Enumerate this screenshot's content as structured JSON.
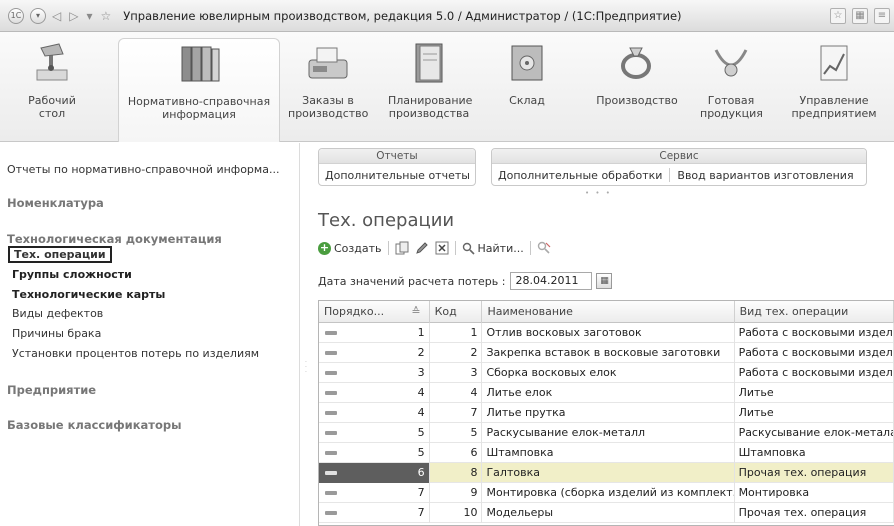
{
  "window": {
    "title": "Управление ювелирным производством, редакция 5.0 / Администратор / (1С:Предприятие)"
  },
  "sections": [
    {
      "label": "Рабочий\nстол",
      "icon": "desk-lamp-icon"
    },
    {
      "label": "Нормативно-справочная\nинформация",
      "icon": "binders-icon",
      "active": true
    },
    {
      "label": "Заказы в\nпроизводство",
      "icon": "fax-icon"
    },
    {
      "label": "Планирование\nпроизводства",
      "icon": "planner-book-icon"
    },
    {
      "label": "Склад",
      "icon": "safe-icon"
    },
    {
      "label": "Производство",
      "icon": "ring-icon"
    },
    {
      "label": "Готовая\nпродукция",
      "icon": "necklace-icon"
    },
    {
      "label": "Управление\nпредприятием",
      "icon": "report-chart-icon"
    }
  ],
  "nav": {
    "top_link": "Отчеты по нормативно-справочной информа...",
    "groups": [
      {
        "title": "Номенклатура",
        "items": []
      },
      {
        "title": "Технологическая документация",
        "items": [
          {
            "label": "Тех. операции",
            "selected": true,
            "bold": true
          },
          {
            "label": "Группы сложности",
            "bold": true
          },
          {
            "label": "Технологические карты",
            "bold": true
          },
          {
            "label": "Виды дефектов"
          },
          {
            "label": "Причины брака"
          },
          {
            "label": "Установки процентов потерь по изделиям"
          }
        ]
      },
      {
        "title": "Предприятие",
        "items": []
      },
      {
        "title": "Базовые классификаторы",
        "items": []
      }
    ]
  },
  "commands": {
    "reports": {
      "header": "Отчеты",
      "items": [
        "Дополнительные отчеты"
      ]
    },
    "service": {
      "header": "Сервис",
      "items": [
        "Дополнительные обработки",
        "Ввод вариантов изготовления"
      ]
    }
  },
  "form": {
    "title": "Тех. операции",
    "toolbar": {
      "create": "Создать",
      "find": "Найти..."
    },
    "date_label": "Дата значений расчета потерь :",
    "date_value": "28.04.2011",
    "columns": [
      "Порядко...",
      "Код",
      "Наименование",
      "Вид тех. операции"
    ],
    "rows": [
      {
        "order": "1",
        "code": "1",
        "name": "Отлив восковых заготовок",
        "type": "Работа с восковыми издел"
      },
      {
        "order": "2",
        "code": "2",
        "name": "Закрепка вставок в восковые заготовки",
        "type": "Работа с восковыми издел"
      },
      {
        "order": "3",
        "code": "3",
        "name": "Сборка восковых елок",
        "type": "Работа с восковыми издел"
      },
      {
        "order": "4",
        "code": "4",
        "name": "Литье елок",
        "type": "Литье"
      },
      {
        "order": "4",
        "code": "7",
        "name": "Литье прутка",
        "type": "Литье"
      },
      {
        "order": "5",
        "code": "5",
        "name": "Раскусывание елок-металл",
        "type": "Раскусывание елок-метала"
      },
      {
        "order": "5",
        "code": "6",
        "name": "Штамповка",
        "type": "Штамповка"
      },
      {
        "order": "6",
        "code": "8",
        "name": "Галтовка",
        "type": "Прочая тех. операция",
        "selected": true
      },
      {
        "order": "7",
        "code": "9",
        "name": "Монтировка (сборка изделий из комплект...",
        "type": "Монтировка"
      },
      {
        "order": "7",
        "code": "10",
        "name": "Модельеры",
        "type": "Прочая тех. операция"
      }
    ]
  }
}
